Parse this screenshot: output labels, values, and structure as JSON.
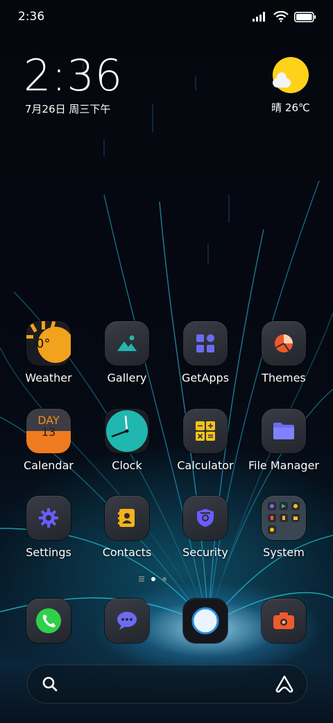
{
  "status_bar": {
    "time": "2:36"
  },
  "lock_widget": {
    "time": "2:36",
    "date": "7月26日 周三下午"
  },
  "weather_widget": {
    "text": "晴 26℃",
    "icon": "sun-cloud-icon"
  },
  "apps": [
    {
      "label": "Weather",
      "icon": "weather-icon"
    },
    {
      "label": "Gallery",
      "icon": "gallery-icon"
    },
    {
      "label": "GetApps",
      "icon": "getapps-icon"
    },
    {
      "label": "Themes",
      "icon": "themes-icon"
    },
    {
      "label": "Calendar",
      "icon": "calendar-icon",
      "icon_text_top": "DAY",
      "icon_text_bottom": "13"
    },
    {
      "label": "Clock",
      "icon": "clock-icon"
    },
    {
      "label": "Calculator",
      "icon": "calculator-icon"
    },
    {
      "label": "File Manager",
      "icon": "folder-icon"
    },
    {
      "label": "Settings",
      "icon": "gear-icon"
    },
    {
      "label": "Contacts",
      "icon": "contacts-icon"
    },
    {
      "label": "Security",
      "icon": "shield-icon"
    },
    {
      "label": "System",
      "icon": "folder-grid-icon"
    }
  ],
  "weather_icon_text": "0°",
  "dock": [
    {
      "icon": "phone-icon"
    },
    {
      "icon": "messages-icon"
    },
    {
      "icon": "browser-icon"
    },
    {
      "icon": "camera-icon"
    }
  ],
  "page_indicator": {
    "pages": 2,
    "current": 1
  },
  "colors": {
    "accent_orange": "#f28c1e",
    "accent_teal": "#1fb7b0",
    "accent_purple": "#6b5cff",
    "accent_yellow": "#f3c31b"
  }
}
